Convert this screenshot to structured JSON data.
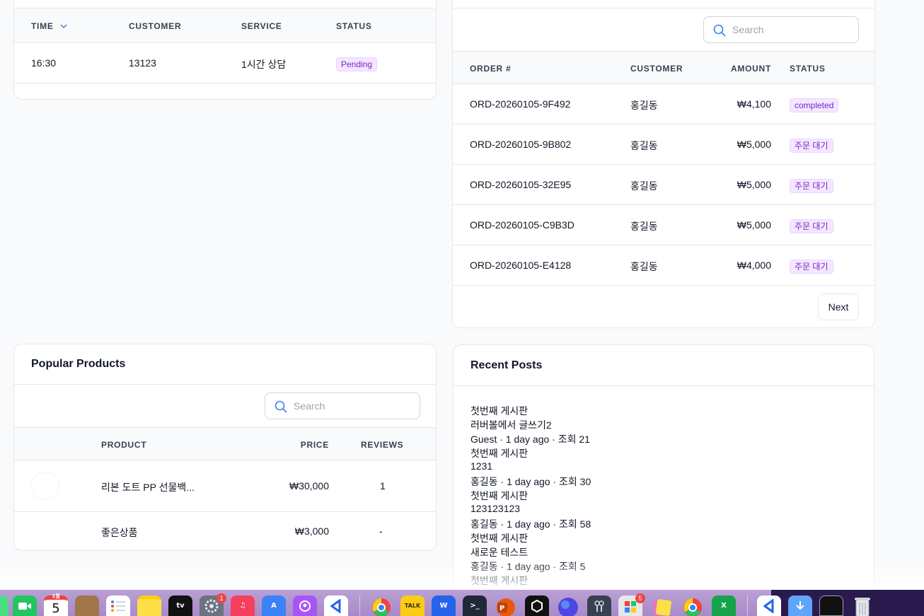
{
  "appointments": {
    "headers": [
      "TIME",
      "CUSTOMER",
      "SERVICE",
      "STATUS"
    ],
    "rows": [
      {
        "time": "16:30",
        "customer": "13123",
        "service": "1시간 상담",
        "status": "Pending"
      }
    ]
  },
  "orders": {
    "search_placeholder": "Search",
    "headers": [
      "ORDER #",
      "CUSTOMER",
      "AMOUNT",
      "STATUS"
    ],
    "rows": [
      {
        "order": "ORD-20260105-9F492",
        "customer": "홍길동",
        "amount": "₩4,100",
        "status": "completed"
      },
      {
        "order": "ORD-20260105-9B802",
        "customer": "홍길동",
        "amount": "₩5,000",
        "status": "주문 대기"
      },
      {
        "order": "ORD-20260105-32E95",
        "customer": "홍길동",
        "amount": "₩5,000",
        "status": "주문 대기"
      },
      {
        "order": "ORD-20260105-C9B3D",
        "customer": "홍길동",
        "amount": "₩5,000",
        "status": "주문 대기"
      },
      {
        "order": "ORD-20260105-E4128",
        "customer": "홍길동",
        "amount": "₩4,000",
        "status": "주문 대기"
      }
    ],
    "next_label": "Next"
  },
  "products": {
    "title": "Popular Products",
    "search_placeholder": "Search",
    "headers": [
      "PRODUCT",
      "PRICE",
      "REVIEWS"
    ],
    "rows": [
      {
        "name": "리본 도트 PP 선물백...",
        "price": "₩30,000",
        "reviews": "1"
      },
      {
        "name": "좋은상품",
        "price": "₩3,000",
        "reviews": "-"
      }
    ]
  },
  "posts": {
    "title": "Recent Posts",
    "items": [
      {
        "board": "첫번째 게시판",
        "title": "러버볼에서 글쓰기2",
        "meta": "Guest · 1 day ago · 조회 21"
      },
      {
        "board": "첫번째 게시판",
        "title": "1231",
        "meta": "홍길동 · 1 day ago · 조회 30"
      },
      {
        "board": "첫번째 게시판",
        "title": "123123123",
        "meta": "홍길동 · 1 day ago · 조회 58"
      },
      {
        "board": "첫번째 게시판",
        "title": "새로운 테스트",
        "meta": "홍길동 · 1 day ago · 조회 5"
      },
      {
        "board": "첫번째 게시판"
      }
    ]
  },
  "dock": {
    "calendar_month": "1월",
    "calendar_day": "5",
    "settings_badge": "1",
    "store_badge": "5",
    "talk_label": "TALK",
    "word_label": "W",
    "excel_label": "X",
    "terminal_label": ">_",
    "colors": {
      "accent": "#7e22ce",
      "badge_bg": "#f3e8ff"
    }
  }
}
